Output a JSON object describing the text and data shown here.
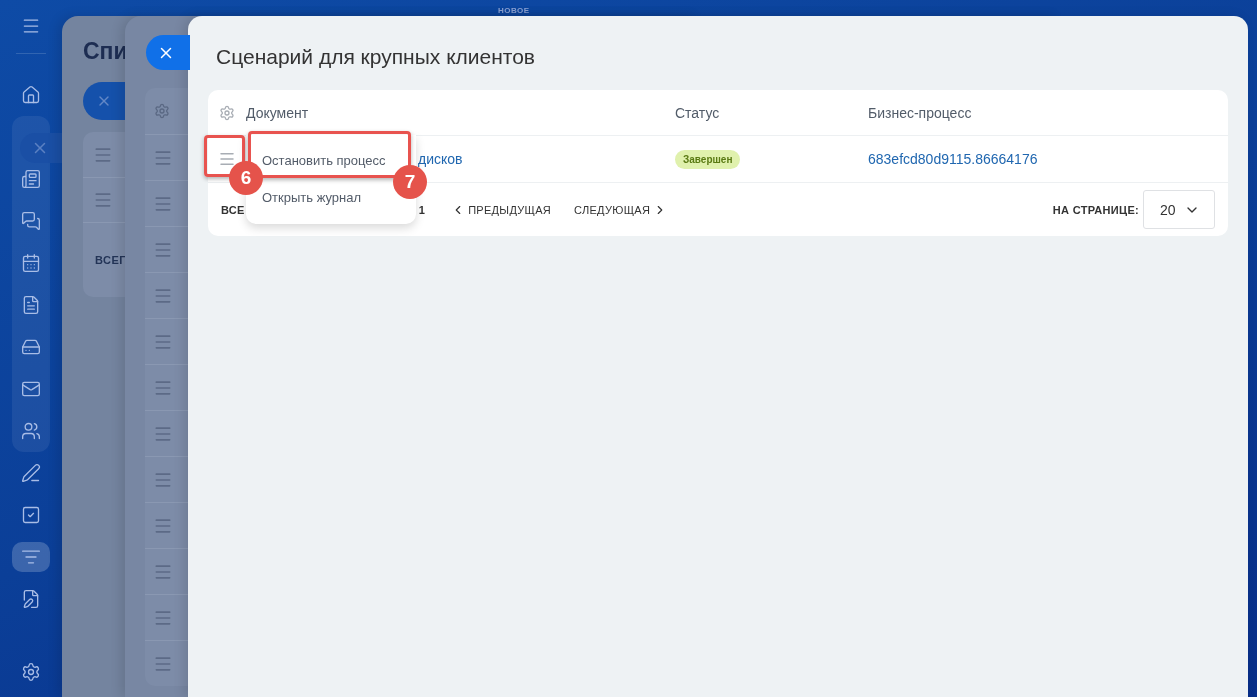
{
  "top_label": "НОВОЕ",
  "nav": {
    "items": [
      {
        "selected": false
      },
      {
        "selected": false
      },
      {
        "selected": false
      },
      {
        "selected": false
      },
      {
        "selected": false
      },
      {
        "selected": false
      },
      {
        "selected": false
      },
      {
        "selected": false
      },
      {
        "selected": false
      },
      {
        "selected": false
      },
      {
        "selected": true
      },
      {
        "selected": false
      }
    ]
  },
  "back_panels": [
    {
      "title": "Спи",
      "footer": "ВСЕГ"
    }
  ],
  "panel": {
    "title": "Сценарий для крупных клиентов",
    "table": {
      "columns": [
        "Документ",
        "Статус",
        "Бизнес-процесс"
      ],
      "rows": [
        {
          "document": "дисков",
          "status": "Завершен",
          "process": "683efcd80d9115.86664176"
        }
      ]
    },
    "footer": {
      "total": "ВСЕ",
      "page": "1",
      "prev": "ПРЕДЫДУЩАЯ",
      "next": "СЛЕДУЮЩАЯ",
      "per_page_label": "НА СТРАНИЦЕ:",
      "per_page": "20"
    }
  },
  "context_menu": [
    "Остановить процесс",
    "Открыть журнал"
  ],
  "callouts": [
    "6",
    "7"
  ]
}
